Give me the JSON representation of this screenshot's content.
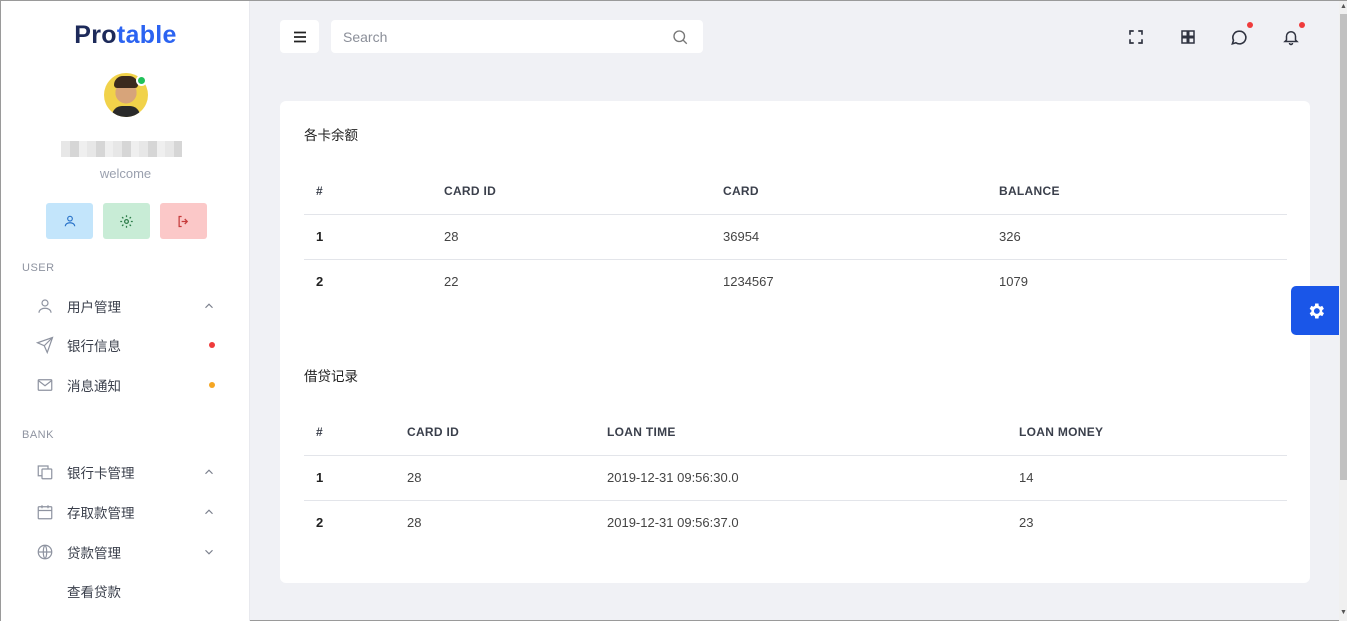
{
  "brand": {
    "part1": "Pro",
    "part2": "table"
  },
  "profile": {
    "welcome": "welcome"
  },
  "quick_actions": [
    "profile",
    "settings",
    "logout"
  ],
  "sections": {
    "user": "USER",
    "bank": "BANK"
  },
  "nav": {
    "user_mgmt": "用户管理",
    "bank_info": "银行信息",
    "messages": "消息通知",
    "card_mgmt": "银行卡管理",
    "deposit_mgmt": "存取款管理",
    "loan_mgmt": "贷款管理",
    "view_loans": "查看贷款"
  },
  "colors": {
    "accent": "#2b63f1",
    "badge_red": "#ef3b3b",
    "badge_orange": "#f5a623",
    "settings_bg": "#1a56e8"
  },
  "search": {
    "placeholder": "Search"
  },
  "balances": {
    "title": "各卡余额",
    "headers": [
      "#",
      "CARD ID",
      "CARD",
      "BALANCE"
    ],
    "rows": [
      [
        "1",
        "28",
        "36954",
        "326"
      ],
      [
        "2",
        "22",
        "1234567",
        "1079"
      ]
    ]
  },
  "loans": {
    "title": "借贷记录",
    "headers": [
      "#",
      "CARD ID",
      "LOAN TIME",
      "LOAN MONEY"
    ],
    "rows": [
      [
        "1",
        "28",
        "2019-12-31 09:56:30.0",
        "14"
      ],
      [
        "2",
        "28",
        "2019-12-31 09:56:37.0",
        "23"
      ]
    ]
  }
}
